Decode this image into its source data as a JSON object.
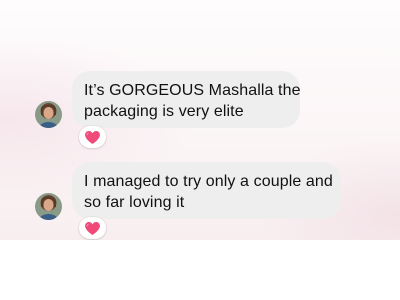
{
  "messages": [
    {
      "lines": [
        "It’s GORGEOUS Mashalla the",
        "packaging is very elite"
      ],
      "reaction": "heart-icon"
    },
    {
      "lines": [
        "I managed to try only a couple and",
        "so far loving it"
      ],
      "reaction": "heart-icon"
    }
  ],
  "colors": {
    "bubble_background": "#eeeeef",
    "text": "#111111",
    "heart": "#f04a7a",
    "reaction_pill": "#ffffff"
  }
}
